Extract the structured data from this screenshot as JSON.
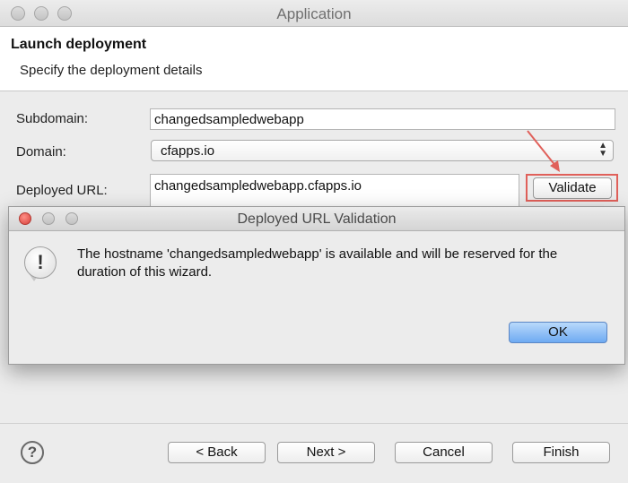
{
  "window": {
    "title": "Application"
  },
  "header": {
    "title": "Launch deployment",
    "subtitle": "Specify the deployment details"
  },
  "form": {
    "subdomain_label": "Subdomain:",
    "subdomain_value": "changedsampledwebapp",
    "domain_label": "Domain:",
    "domain_value": "cfapps.io",
    "deployed_url_label": "Deployed URL:",
    "deployed_url_value": "changedsampledwebapp.cfapps.io",
    "validate_label": "Validate"
  },
  "footer": {
    "help_symbol": "?",
    "back_label": "< Back",
    "next_label": "Next >",
    "cancel_label": "Cancel",
    "finish_label": "Finish"
  },
  "dialog": {
    "title": "Deployed URL Validation",
    "alert_symbol": "!",
    "message": "The hostname 'changedsampledwebapp' is available and will be reserved for the duration of this wizard.",
    "ok_label": "OK"
  },
  "colors": {
    "annotation_red": "#e0605a",
    "close_red": "#e4524a",
    "ok_blue": "#6eaaf2"
  },
  "icons": {
    "help": "question-circle-icon",
    "alert": "exclamation-bubble-icon",
    "select": "chevron-updown-icon"
  }
}
